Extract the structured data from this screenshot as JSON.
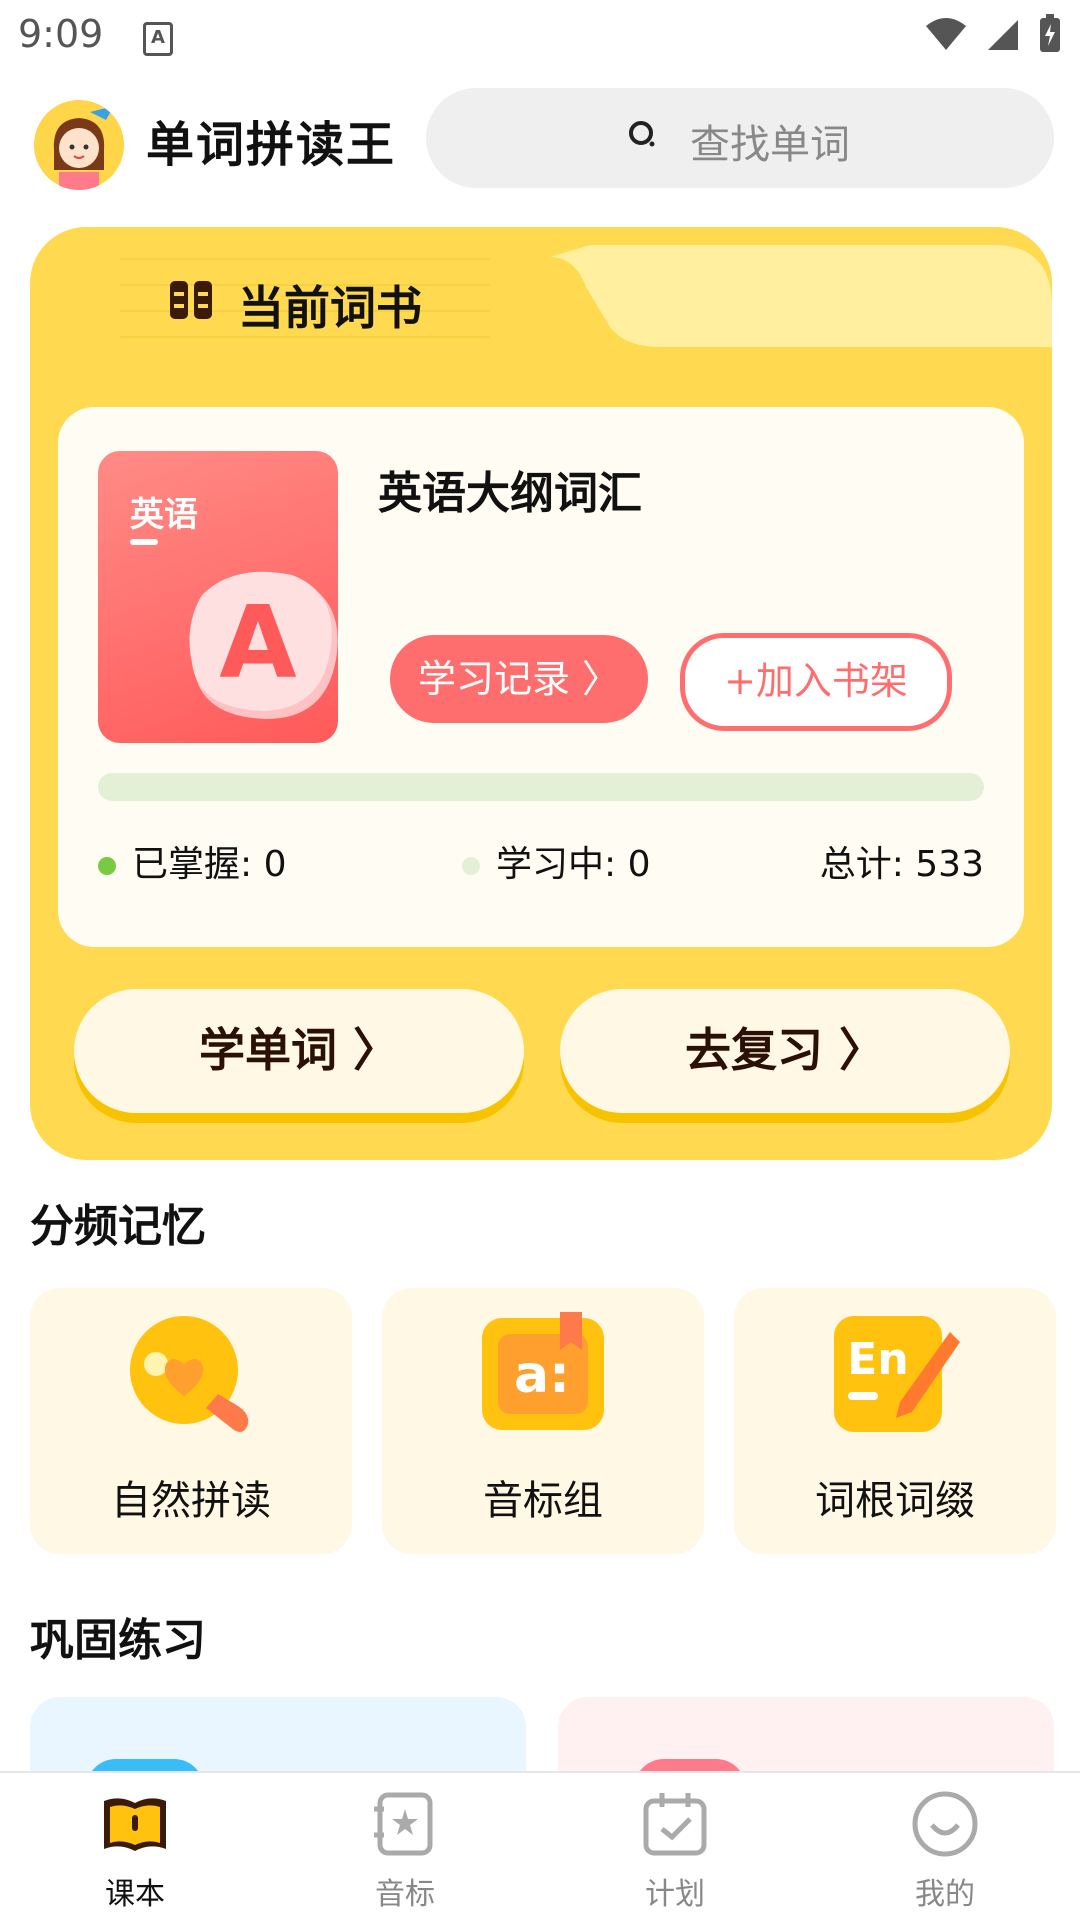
{
  "status": {
    "time": "9:09",
    "app_icon_letter": "A"
  },
  "header": {
    "app_title": "单词拼读王",
    "search_placeholder": "查找单词"
  },
  "current_book": {
    "section_title": "当前词书",
    "cover_label": "英语",
    "cover_letter": "A",
    "name": "英语大纲词汇",
    "record_button": "学习记录 〉",
    "add_button": "+加入书架",
    "progress_fraction": 0,
    "stats": {
      "mastered": "已掌握: 0",
      "learning": "学习中: 0",
      "total": "总计: 533"
    },
    "learn_button": "学单词 〉",
    "review_button": "去复习 〉"
  },
  "memory": {
    "title": "分频记忆",
    "items": [
      {
        "label": "自然拼读",
        "icon": "phonics-bulb-icon"
      },
      {
        "label": "音标组",
        "icon": "phonetic-card-icon"
      },
      {
        "label": "词根词缀",
        "icon": "en-pencil-icon"
      }
    ]
  },
  "practice": {
    "title": "巩固练习"
  },
  "tabbar": {
    "items": [
      {
        "label": "课本",
        "icon": "book-icon",
        "active": true
      },
      {
        "label": "音标",
        "icon": "phonetic-icon",
        "active": false
      },
      {
        "label": "计划",
        "icon": "calendar-icon",
        "active": false
      },
      {
        "label": "我的",
        "icon": "smile-icon",
        "active": false
      }
    ]
  },
  "colors": {
    "accent_yellow": "#ffd94f",
    "accent_red": "#ff6e6e",
    "mastered_green": "#7ac943",
    "learning_green": "#e4f0d6"
  }
}
